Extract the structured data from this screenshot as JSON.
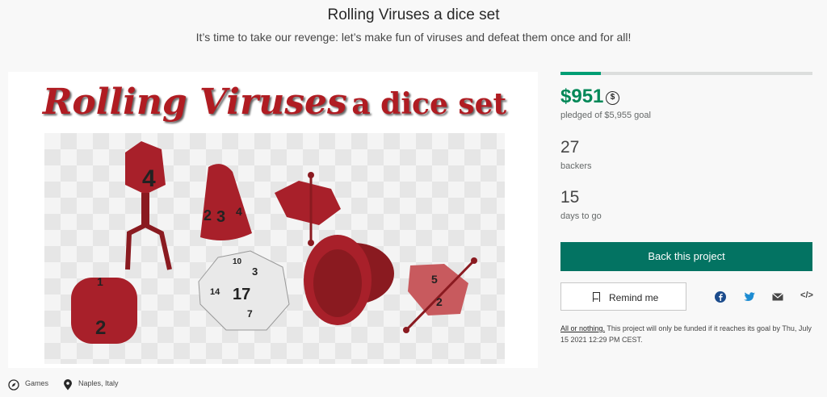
{
  "project": {
    "title": "Rolling Viruses a dice set",
    "blurb": "It’s time to take our revenge: let’s make fun of viruses and defeat them once and for all!"
  },
  "hero": {
    "title_main": "Rolling Viruses",
    "title_rest": "a dice set",
    "dice_numbers": [
      "4",
      "2",
      "3",
      "4",
      "2",
      "17",
      "10",
      "3",
      "14",
      "7",
      "5",
      "1",
      "2"
    ]
  },
  "funding": {
    "progress_fraction": 0.16,
    "pledged": "$951",
    "currency_icon": "$",
    "goal_text": "pledged of $5,955 goal",
    "backers": "27",
    "backers_label": "backers",
    "days": "15",
    "days_label": "days to go"
  },
  "actions": {
    "back_label": "Back this project",
    "remind_label": "Remind me"
  },
  "share": {
    "icons": [
      "facebook-icon",
      "twitter-icon",
      "email-icon",
      "embed-icon"
    ],
    "embed_glyph": "</>"
  },
  "fine_print": {
    "link": "All or nothing.",
    "text": " This project will only be funded if it reaches its goal by Thu, July 15 2021 12:29 PM CEST."
  },
  "meta": {
    "category": "Games",
    "location": "Naples, Italy"
  },
  "colors": {
    "brand_green": "#037362",
    "amount_green": "#028858",
    "dice_red": "#b01c22"
  }
}
